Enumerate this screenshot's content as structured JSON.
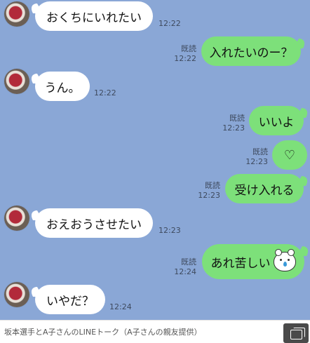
{
  "messages": [
    {
      "side": "in",
      "text": "おくちにいれたい",
      "time": "12:22",
      "read": ""
    },
    {
      "side": "out",
      "text": "入れたいのー？",
      "time": "12:22",
      "read": "既読"
    },
    {
      "side": "in",
      "text": "うん。",
      "time": "12:22",
      "read": ""
    },
    {
      "side": "out",
      "text": "いいよ",
      "time": "12:23",
      "read": "既読"
    },
    {
      "side": "out",
      "text": "♡",
      "time": "12:23",
      "read": "既読"
    },
    {
      "side": "out",
      "text": "受け入れる",
      "time": "12:23",
      "read": "既読"
    },
    {
      "side": "in",
      "text": "おえおうさせたい",
      "time": "12:23",
      "read": ""
    },
    {
      "side": "out",
      "text": "あれ苦しい",
      "time": "12:24",
      "read": "既読",
      "sticker": "crying-bear-icon"
    },
    {
      "side": "in",
      "text": "いやだ？",
      "time": "12:24",
      "read": ""
    }
  ],
  "caption": "坂本選手とA子さんのLINEトーク（A子さんの親友提供）",
  "colors": {
    "background": "#8aa7d6",
    "incoming_bubble": "#ffffff",
    "outgoing_bubble": "#7de07a"
  }
}
